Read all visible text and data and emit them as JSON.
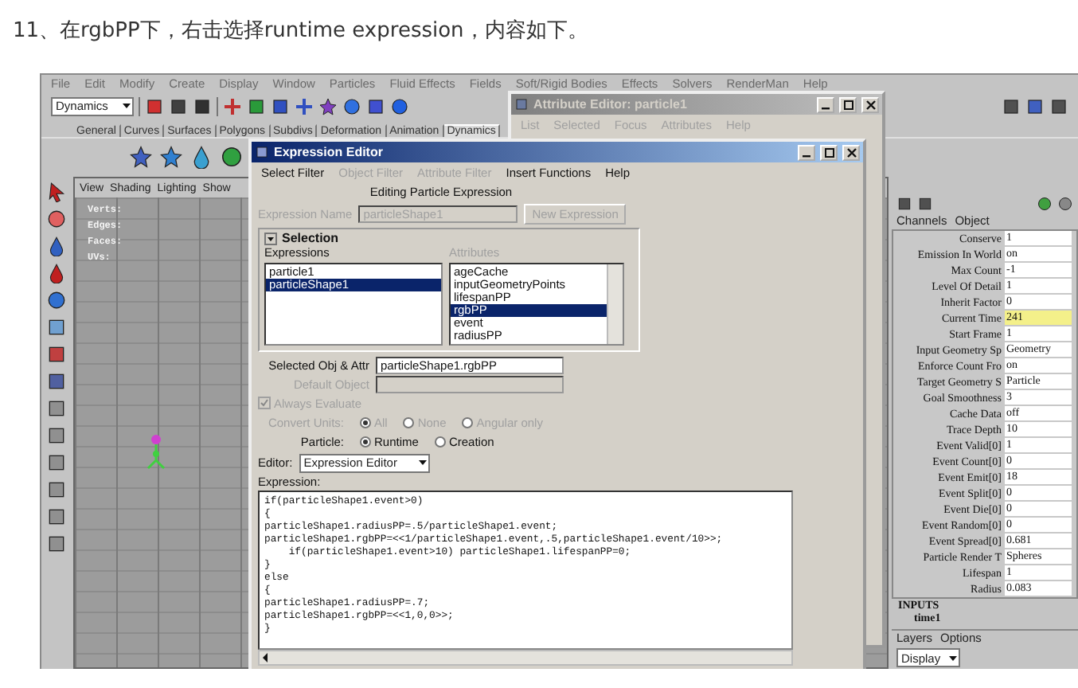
{
  "caption": "11、在rgbPP下，右击选择runtime expression，内容如下。",
  "maya": {
    "menu": [
      "File",
      "Edit",
      "Modify",
      "Create",
      "Display",
      "Window",
      "Particles",
      "Fluid Effects",
      "Fields",
      "Soft/Rigid Bodies",
      "Effects",
      "Solvers",
      "RenderMan",
      "Help"
    ],
    "mode_dropdown": "Dynamics",
    "shelf_tabs": [
      {
        "label": "General",
        "selected": false
      },
      {
        "label": "Curves",
        "selected": false
      },
      {
        "label": "Surfaces",
        "selected": false
      },
      {
        "label": "Polygons",
        "selected": false
      },
      {
        "label": "Subdivs",
        "selected": false
      },
      {
        "label": "Deformation",
        "selected": false
      },
      {
        "label": "Animation",
        "selected": false
      },
      {
        "label": "Dynamics",
        "selected": true
      }
    ],
    "viewport": {
      "menu": [
        "View",
        "Shading",
        "Lighting",
        "Show"
      ],
      "hud": [
        "Verts:",
        "Edges:",
        "Faces:",
        "UVs:"
      ]
    },
    "channel_box": {
      "tabs": [
        "Channels",
        "Object"
      ],
      "rows": [
        {
          "label": "Conserve",
          "value": "1",
          "highlighted": false
        },
        {
          "label": "Emission In World",
          "value": "on",
          "highlighted": false
        },
        {
          "label": "Max Count",
          "value": "-1",
          "highlighted": false
        },
        {
          "label": "Level Of Detail",
          "value": "1",
          "highlighted": false
        },
        {
          "label": "Inherit Factor",
          "value": "0",
          "highlighted": false
        },
        {
          "label": "Current Time",
          "value": "241",
          "highlighted": true
        },
        {
          "label": "Start Frame",
          "value": "1",
          "highlighted": false
        },
        {
          "label": "Input Geometry Sp",
          "value": "Geometry",
          "highlighted": false
        },
        {
          "label": "Enforce Count Fro",
          "value": "on",
          "highlighted": false
        },
        {
          "label": "Target Geometry S",
          "value": "Particle",
          "highlighted": false
        },
        {
          "label": "Goal Smoothness",
          "value": "3",
          "highlighted": false
        },
        {
          "label": "Cache Data",
          "value": "off",
          "highlighted": false
        },
        {
          "label": "Trace Depth",
          "value": "10",
          "highlighted": false
        },
        {
          "label": "Event Valid[0]",
          "value": "1",
          "highlighted": false
        },
        {
          "label": "Event Count[0]",
          "value": "0",
          "highlighted": false
        },
        {
          "label": "Event Emit[0]",
          "value": "18",
          "highlighted": false
        },
        {
          "label": "Event Split[0]",
          "value": "0",
          "highlighted": false
        },
        {
          "label": "Event Die[0]",
          "value": "0",
          "highlighted": false
        },
        {
          "label": "Event Random[0]",
          "value": "0",
          "highlighted": false
        },
        {
          "label": "Event Spread[0]",
          "value": "0.681",
          "highlighted": false
        },
        {
          "label": "Particle Render T",
          "value": "Spheres",
          "highlighted": false
        },
        {
          "label": "Lifespan",
          "value": "1",
          "highlighted": false
        },
        {
          "label": "Radius",
          "value": "0.083",
          "highlighted": false
        }
      ],
      "inputs_heading": "INPUTS",
      "input_item": "time1"
    },
    "layers": {
      "menu": [
        "Layers",
        "Options"
      ],
      "dropdown": "Display"
    }
  },
  "attribute_editor": {
    "title": "Attribute Editor: particle1",
    "menu": [
      "List",
      "Selected",
      "Focus",
      "Attributes",
      "Help"
    ]
  },
  "expression_editor": {
    "title": "Expression Editor",
    "menu": [
      {
        "label": "Select Filter",
        "disabled": false
      },
      {
        "label": "Object Filter",
        "disabled": true
      },
      {
        "label": "Attribute Filter",
        "disabled": true
      },
      {
        "label": "Insert Functions",
        "disabled": false
      },
      {
        "label": "Help",
        "disabled": false
      }
    ],
    "heading": "Editing Particle Expression",
    "name_label": "Expression Name",
    "name_value": "particleShape1",
    "new_button": "New Expression",
    "section": {
      "title": "Selection",
      "expanded": true
    },
    "expressions_label": "Expressions",
    "attributes_label": "Attributes",
    "expressions": [
      {
        "label": "particle1",
        "selected": false
      },
      {
        "label": "particleShape1",
        "selected": true
      }
    ],
    "attributes": [
      {
        "label": "ageCache",
        "selected": false
      },
      {
        "label": "inputGeometryPoints",
        "selected": false
      },
      {
        "label": "lifespanPP",
        "selected": false
      },
      {
        "label": "rgbPP",
        "selected": true
      },
      {
        "label": "event",
        "selected": false
      },
      {
        "label": "radiusPP",
        "selected": false
      }
    ],
    "selected_label": "Selected Obj & Attr",
    "selected_value": "particleShape1.rgbPP",
    "default_label": "Default Object",
    "always_evaluate": {
      "label": "Always Evaluate",
      "checked": true,
      "disabled": true
    },
    "convert_units": {
      "label": "Convert Units:",
      "disabled": true,
      "options": [
        {
          "label": "All",
          "selected": true
        },
        {
          "label": "None",
          "selected": false
        },
        {
          "label": "Angular only",
          "selected": false
        }
      ]
    },
    "particle": {
      "label": "Particle:",
      "disabled": false,
      "options": [
        {
          "label": "Runtime",
          "selected": true
        },
        {
          "label": "Creation",
          "selected": false
        }
      ]
    },
    "editor_label": "Editor:",
    "editor_value": "Expression Editor",
    "expression_label": "Expression:",
    "code_lines": [
      "if(particleShape1.event>0)",
      "{",
      "particleShape1.radiusPP=.5/particleShape1.event;",
      "particleShape1.rgbPP=<<1/particleShape1.event,.5,particleShape1.event/10>>;",
      "    if(particleShape1.event>10) particleShape1.lifespanPP=0;",
      "}",
      "else",
      "{",
      "particleShape1.radiusPP=.7;",
      "particleShape1.rgbPP=<<1,0,0>>;",
      "}"
    ]
  }
}
